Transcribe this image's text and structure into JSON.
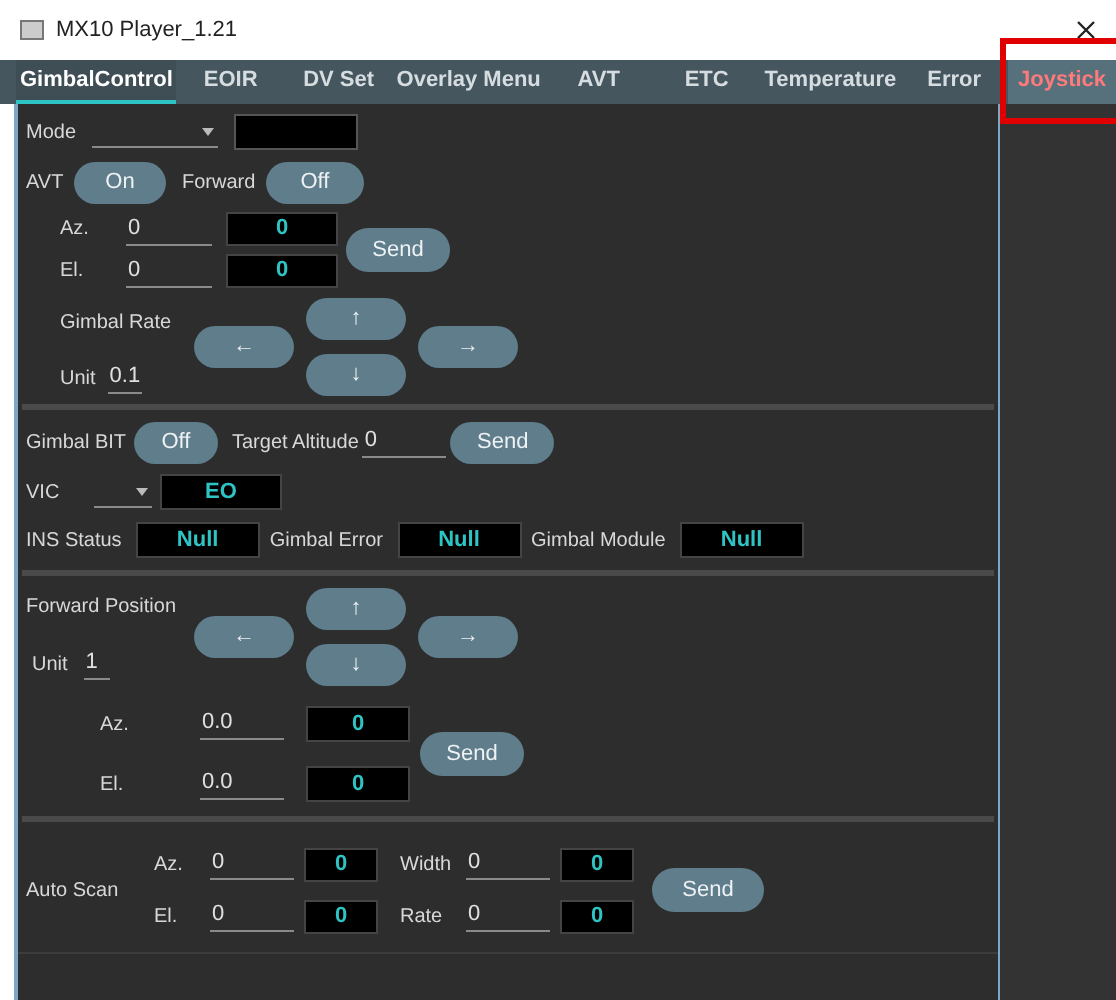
{
  "window": {
    "title": "MX10 Player_1.21"
  },
  "tabs": [
    {
      "label": "GimbalControl",
      "selected": true,
      "highlighted": false
    },
    {
      "label": "EOIR",
      "selected": false,
      "highlighted": false
    },
    {
      "label": "DV Set",
      "selected": false,
      "highlighted": false
    },
    {
      "label": "Overlay Menu",
      "selected": false,
      "highlighted": false
    },
    {
      "label": "AVT",
      "selected": false,
      "highlighted": false
    },
    {
      "label": "ETC",
      "selected": false,
      "highlighted": false
    },
    {
      "label": "Temperature",
      "selected": false,
      "highlighted": false
    },
    {
      "label": "Error",
      "selected": false,
      "highlighted": false
    },
    {
      "label": "Joystick",
      "selected": false,
      "highlighted": true
    }
  ],
  "gimbal_rate": {
    "mode_label": "Mode",
    "avt_label": "AVT",
    "avt_button": "On",
    "forward_label": "Forward",
    "forward_button": "Off",
    "az_label": "Az.",
    "az_value": "0",
    "az_readout": "0",
    "el_label": "El.",
    "el_value": "0",
    "el_readout": "0",
    "send": "Send",
    "rate_label": "Gimbal Rate",
    "unit_label": "Unit",
    "unit_value": "0.1",
    "arrows": [
      "↑",
      "←",
      "→",
      "↓"
    ]
  },
  "status": {
    "bit_label": "Gimbal BIT",
    "bit_button": "Off",
    "altitude_label": "Target Altitude",
    "altitude_value": "0",
    "send": "Send",
    "vic_label": "VIC",
    "vic_readout": "EO",
    "indicators": [
      {
        "label": "INS Status",
        "value": "Null"
      },
      {
        "label": "Gimbal Error",
        "value": "Null"
      },
      {
        "label": "Gimbal Module",
        "value": "Null"
      }
    ]
  },
  "forward_position": {
    "label": "Forward Position",
    "unit_label": "Unit",
    "unit_value": "1",
    "arrows": [
      "↑",
      "←",
      "→",
      "↓"
    ],
    "az_label": "Az.",
    "az_value": "0.0",
    "az_readout": "0",
    "el_label": "El.",
    "el_value": "0.0",
    "el_readout": "0",
    "send": "Send"
  },
  "auto_scan": {
    "label": "Auto Scan",
    "fields": [
      {
        "label": "Az.",
        "value": "0",
        "readout": "0"
      },
      {
        "label": "Width",
        "value": "0",
        "readout": "0"
      },
      {
        "label": "El.",
        "value": "0",
        "readout": "0"
      },
      {
        "label": "Rate",
        "value": "0",
        "readout": "0"
      }
    ],
    "send": "Send"
  }
}
